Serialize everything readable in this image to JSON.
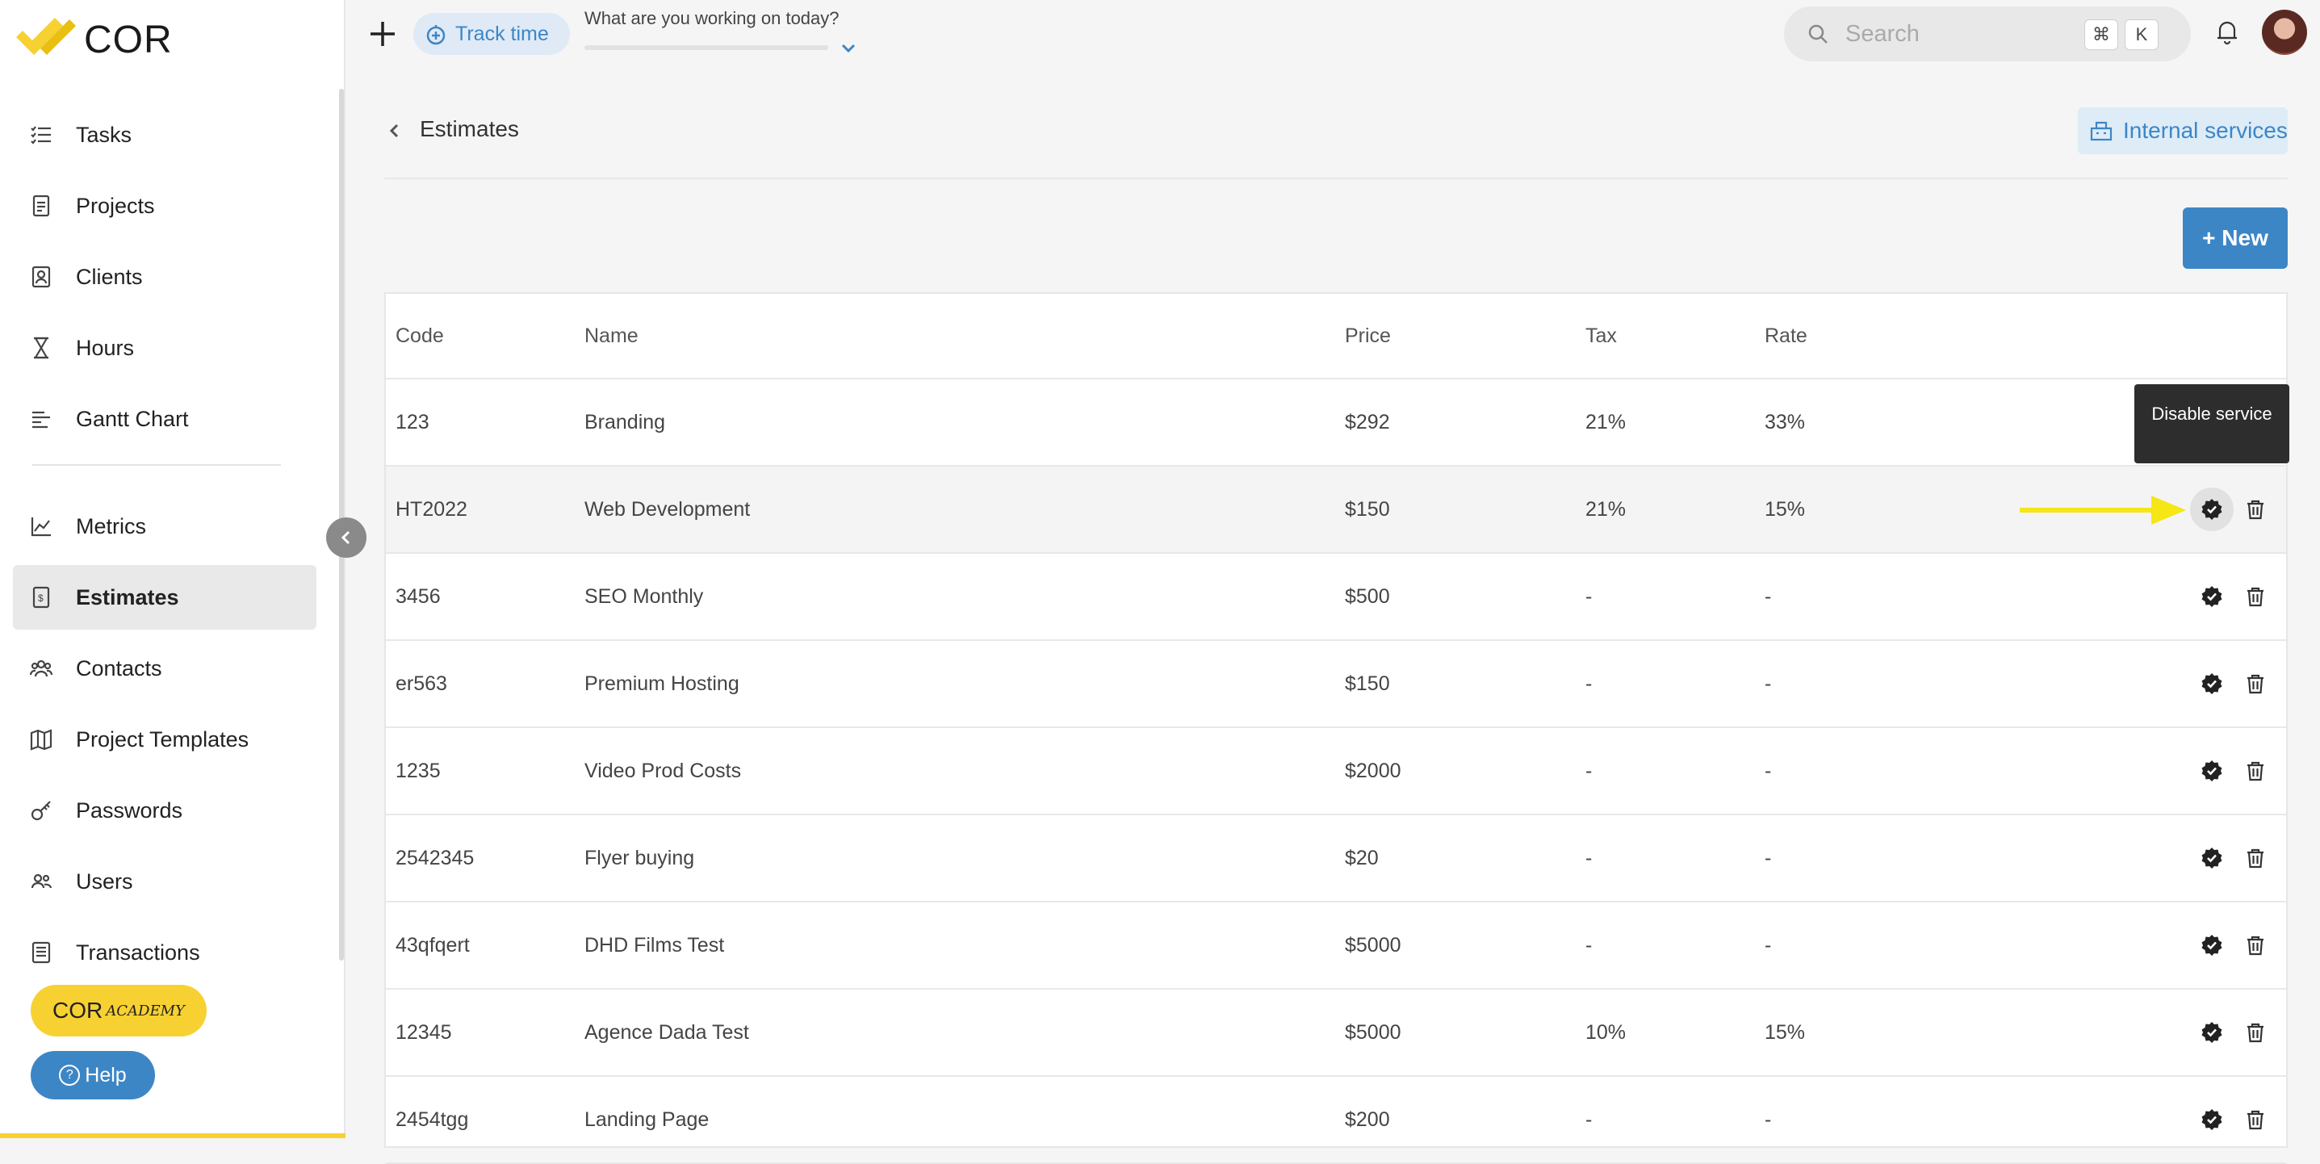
{
  "brand": {
    "name": "COR",
    "accent": "#3d86c6",
    "logo_color": "#f7d132"
  },
  "sidebar": {
    "items": [
      {
        "label": "Tasks",
        "icon": "tasks-icon"
      },
      {
        "label": "Projects",
        "icon": "projects-icon"
      },
      {
        "label": "Clients",
        "icon": "clients-icon"
      },
      {
        "label": "Hours",
        "icon": "hourglass-icon"
      },
      {
        "label": "Gantt Chart",
        "icon": "gantt-icon"
      },
      {
        "label": "Metrics",
        "icon": "metrics-icon"
      },
      {
        "label": "Estimates",
        "icon": "estimates-icon",
        "active": true
      },
      {
        "label": "Contacts",
        "icon": "contacts-icon"
      },
      {
        "label": "Project Templates",
        "icon": "map-icon"
      },
      {
        "label": "Passwords",
        "icon": "key-icon"
      },
      {
        "label": "Users",
        "icon": "users-icon"
      },
      {
        "label": "Transactions",
        "icon": "transactions-icon"
      }
    ],
    "academy_label": "COR",
    "academy_sub": "ACADEMY",
    "help_label": "Help"
  },
  "topbar": {
    "track_time_label": "Track time",
    "working_prompt": "What are you working on today?",
    "search_placeholder": "Search",
    "kbd_cmd": "⌘",
    "kbd_k": "K"
  },
  "page": {
    "title": "Estimates",
    "internal_services_label": "Internal services",
    "new_button_label": "+ New"
  },
  "table": {
    "headers": {
      "code": "Code",
      "name": "Name",
      "price": "Price",
      "tax": "Tax",
      "rate": "Rate"
    },
    "rows": [
      {
        "code": "123",
        "name": "Branding",
        "price": "$292",
        "tax": "21%",
        "rate": "33%"
      },
      {
        "code": "HT2022",
        "name": "Web Development",
        "price": "$150",
        "tax": "21%",
        "rate": "15%"
      },
      {
        "code": "3456",
        "name": "SEO Monthly",
        "price": "$500",
        "tax": "-",
        "rate": "-"
      },
      {
        "code": "er563",
        "name": "Premium Hosting",
        "price": "$150",
        "tax": "-",
        "rate": "-"
      },
      {
        "code": "1235",
        "name": "Video Prod Costs",
        "price": "$2000",
        "tax": "-",
        "rate": "-"
      },
      {
        "code": "2542345",
        "name": "Flyer buying",
        "price": "$20",
        "tax": "-",
        "rate": "-"
      },
      {
        "code": "43qfqert",
        "name": "DHD Films Test",
        "price": "$5000",
        "tax": "-",
        "rate": "-"
      },
      {
        "code": "12345",
        "name": "Agence Dada Test",
        "price": "$5000",
        "tax": "10%",
        "rate": "15%"
      },
      {
        "code": "2454tgg",
        "name": "Landing Page",
        "price": "$200",
        "tax": "-",
        "rate": "-"
      }
    ]
  },
  "tooltip": {
    "text": "Disable service"
  },
  "annotation": {
    "arrow_color": "#f5e616"
  }
}
